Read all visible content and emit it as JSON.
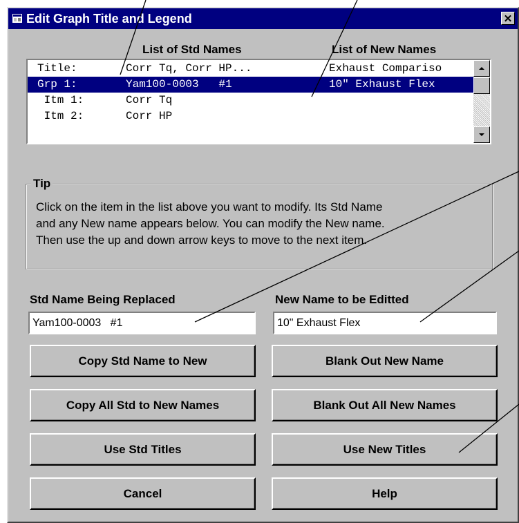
{
  "window": {
    "title": "Edit Graph Title and Legend",
    "close_glyph": "✕",
    "title_icon": "window-app-icon",
    "titlebar_color": "#000080",
    "face_color": "#c0c0c0"
  },
  "list": {
    "std_header": "List of Std Names",
    "new_header": "List of New Names",
    "rows": [
      {
        "tag": "Title:",
        "std": "Corr Tq, Corr HP...",
        "new": "Exhaust Compariso",
        "selected": false
      },
      {
        "tag": "Grp 1:",
        "std": "Yam100-0003   #1",
        "new": "10\" Exhaust Flex",
        "selected": true
      },
      {
        "tag": " Itm 1:",
        "std": "Corr Tq",
        "new": "",
        "selected": false
      },
      {
        "tag": " Itm 2:",
        "std": "Corr HP",
        "new": "",
        "selected": false
      }
    ],
    "scroll_up_icon": "scroll-up-arrow-icon",
    "scroll_down_icon": "scroll-down-arrow-icon"
  },
  "tip": {
    "label": "Tip",
    "lines": [
      "Click on the item in the list above you want to modify.  Its Std Name",
      "and any New name appears below.  You can modify the New name.",
      "Then use the up and down arrow keys to move to the next item."
    ]
  },
  "std_field": {
    "label": "Std Name Being Replaced",
    "value": "Yam100-0003   #1"
  },
  "new_field": {
    "label": "New Name to be Editted",
    "value": "10\" Exhaust Flex"
  },
  "buttons": {
    "copy_std": "Copy Std Name to New",
    "blank_new": "Blank Out New Name",
    "copy_all": "Copy All Std to New Names",
    "blank_all": "Blank Out All New Names",
    "use_std": "Use Std Titles",
    "use_new": "Use New Titles",
    "cancel": "Cancel",
    "help": "Help"
  }
}
